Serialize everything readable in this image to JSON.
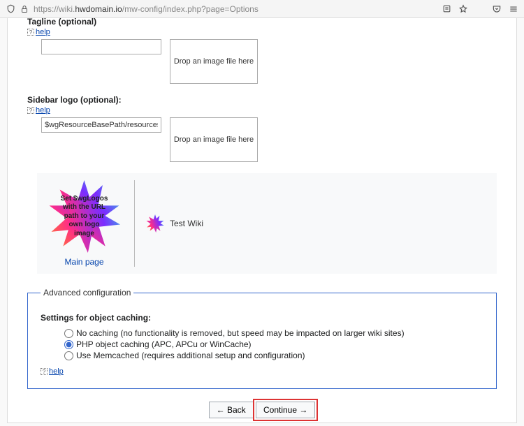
{
  "browser": {
    "url_prefix": "https://wiki.",
    "url_domain": "hwdomain.io",
    "url_path": "/mw-config/index.php?page=Options"
  },
  "tagline": {
    "label": "Tagline (optional)",
    "help": "help",
    "value": "",
    "dropzone": "Drop an image file here"
  },
  "sidebar_logo": {
    "label": "Sidebar logo (optional):",
    "help": "help",
    "value": "$wgResourceBasePath/resources/assets/ch",
    "dropzone": "Drop an image file here"
  },
  "preview": {
    "logo_text": "Set $wgLogos with the URL path to your own logo image",
    "main_page": "Main page",
    "wiki_name": "Test Wiki"
  },
  "advanced": {
    "legend": "Advanced configuration",
    "settings_label": "Settings for object caching:",
    "options": [
      {
        "label": "No caching (no functionality is removed, but speed may be impacted on larger wiki sites)",
        "checked": false
      },
      {
        "label": "PHP object caching (APC, APCu or WinCache)",
        "checked": true
      },
      {
        "label": "Use Memcached (requires additional setup and configuration)",
        "checked": false
      }
    ],
    "help": "help"
  },
  "buttons": {
    "back": "← Back",
    "continue": "Continue →"
  }
}
